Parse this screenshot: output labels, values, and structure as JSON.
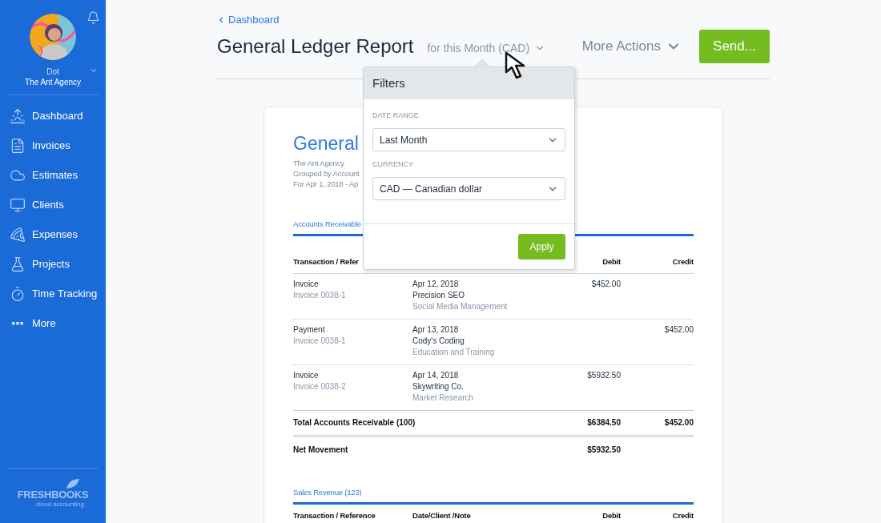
{
  "sidebar": {
    "user": {
      "name": "Dot",
      "company": "The Ant Agency"
    },
    "items": [
      {
        "label": "Dashboard"
      },
      {
        "label": "Invoices"
      },
      {
        "label": "Estimates"
      },
      {
        "label": "Clients"
      },
      {
        "label": "Expenses"
      },
      {
        "label": "Projects"
      },
      {
        "label": "Time Tracking"
      },
      {
        "label": "More"
      }
    ],
    "logo": {
      "name": "FRESHBOOKS",
      "tagline": "cloud accounting"
    }
  },
  "header": {
    "back_link": "Dashboard",
    "title": "General Ledger Report",
    "period": "for this Month (CAD)",
    "more_actions": "More Actions",
    "send_button": "Send..."
  },
  "filters": {
    "title": "Filters",
    "fields": [
      {
        "label": "DATE RANGE",
        "value": "Last Month"
      },
      {
        "label": "CURRENCY",
        "value": "CAD — Canadian dollar"
      }
    ],
    "apply_button": "Apply"
  },
  "report": {
    "title": "General",
    "company": "The Ant Agency",
    "grouping": "Grouped by Account",
    "range": "For Apr 1, 2018 - Ap",
    "sections": [
      {
        "name": "Accounts Receivable",
        "columns": [
          "Transaction / Refer",
          "",
          "Debit",
          "Credit"
        ],
        "rows": [
          {
            "type": "Invoice",
            "reference": "Invoice 0038-1",
            "date": "Apr 12, 2018",
            "client": "Precision SEO",
            "note": "Social Media Management",
            "debit": "$452.00",
            "credit": ""
          },
          {
            "type": "Payment",
            "reference": "Invoice 0038-1",
            "date": "Apr 13, 2018",
            "client": "Cody's Coding",
            "note": "Education and Training",
            "debit": "",
            "credit": "$452.00"
          },
          {
            "type": "Invoice",
            "reference": "Invoice 0038-2",
            "date": "Apr 14, 2018",
            "client": "Skywriting Co.",
            "note": "Market Research",
            "debit": "$5932.50",
            "credit": ""
          }
        ],
        "total": {
          "label": "Total Accounts Receivable (100)",
          "debit": "$6384.50",
          "credit": "$452.00"
        },
        "net": {
          "label": "Net Movement",
          "debit": "$5932.50"
        }
      },
      {
        "name": "Sales Revenue (123)",
        "columns": [
          "Transaction / Reference",
          "Date/Client /Note",
          "Debit",
          "Credit"
        ]
      }
    ]
  }
}
